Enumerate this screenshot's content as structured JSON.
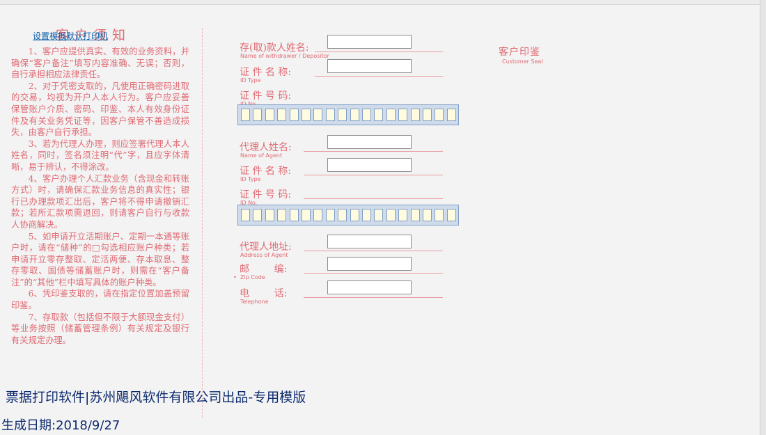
{
  "toolbar": {
    "print_link": "设置模板默认打印机"
  },
  "notice": {
    "title": "客户须知",
    "paragraphs": [
      "1、客户应提供真实、有效的业务资料，并确保“客户备注”填写内容准确、无误；否则，自行承担相应法律责任。",
      "2、对于凭密支取的，凡使用正确密码进取的交易，均视为开户人本人行为。客户应妥善保管账户介质、密码、印鉴、本人有效身份证件及有关业务凭证等，因客户保管不善造成损失，由客户自行承担。",
      "3、若为代理人办理，则应签署代理人本人姓名，同时，签名须注明“代”字，且应字体清晰，易于辨认，不得涂改。",
      "4、客户办理个人汇款业务（含现金和转账方式）时，请确保汇款业务信息的真实性；银行已办理款项汇出后，客户将不得申请撤销汇款；若所汇款项需退回，则请客户自行与收款人协商解决。",
      "5、如申请开立活期账户、定期一本通等账户时，请在“储种”的□勾选相应账户种类；若申请开立零存整取、定活两便、存本取息、整存零取、国债等储蓄账户时，则需在“客户备注”的“其他”栏中填写具体的账户种类。",
      "6、凭印鉴支取的，请在指定位置加盖预留印鉴。",
      "7、存取款（包括但不限于大额现金支付）等业务按照（储蓄管理条例）有关规定及银行有关规定办理。"
    ]
  },
  "form": {
    "depositor_name": {
      "label": "存(取)款人姓名:",
      "en": "Name of withdrawer / Depositor",
      "value": ""
    },
    "id_type": {
      "label": "证 件 名 称:",
      "en": "ID Type",
      "value": ""
    },
    "id_no": {
      "label": "证 件 号 码:",
      "en": "ID No.",
      "digits": 18
    },
    "agent_name": {
      "label": "代理人姓名:",
      "en": "Name of Agent",
      "value": ""
    },
    "agent_id_type": {
      "label": "证 件 名 称:",
      "en": "ID Type",
      "value": ""
    },
    "agent_id_no": {
      "label": "证 件 号 码:",
      "en": "ID No.",
      "digits": 18
    },
    "agent_address": {
      "label": "代理人地址:",
      "en": "Address of Agent",
      "value": ""
    },
    "zip_code": {
      "label": "邮        编:",
      "en": "Zip Code",
      "value": ""
    },
    "telephone": {
      "label": "电        话:",
      "en": "Telephone",
      "value": ""
    }
  },
  "seal": {
    "cn": "客户印鉴",
    "en": "Customer Seal"
  },
  "footer": {
    "product": "票据打印软件|苏州飓风软件有限公司出品-专用模版",
    "generated": "生成日期:2018/9/27"
  },
  "colors": {
    "form_red": "#e06a73",
    "footer_blue": "#0e2b6e",
    "strip_blue": "#cfdbea"
  }
}
